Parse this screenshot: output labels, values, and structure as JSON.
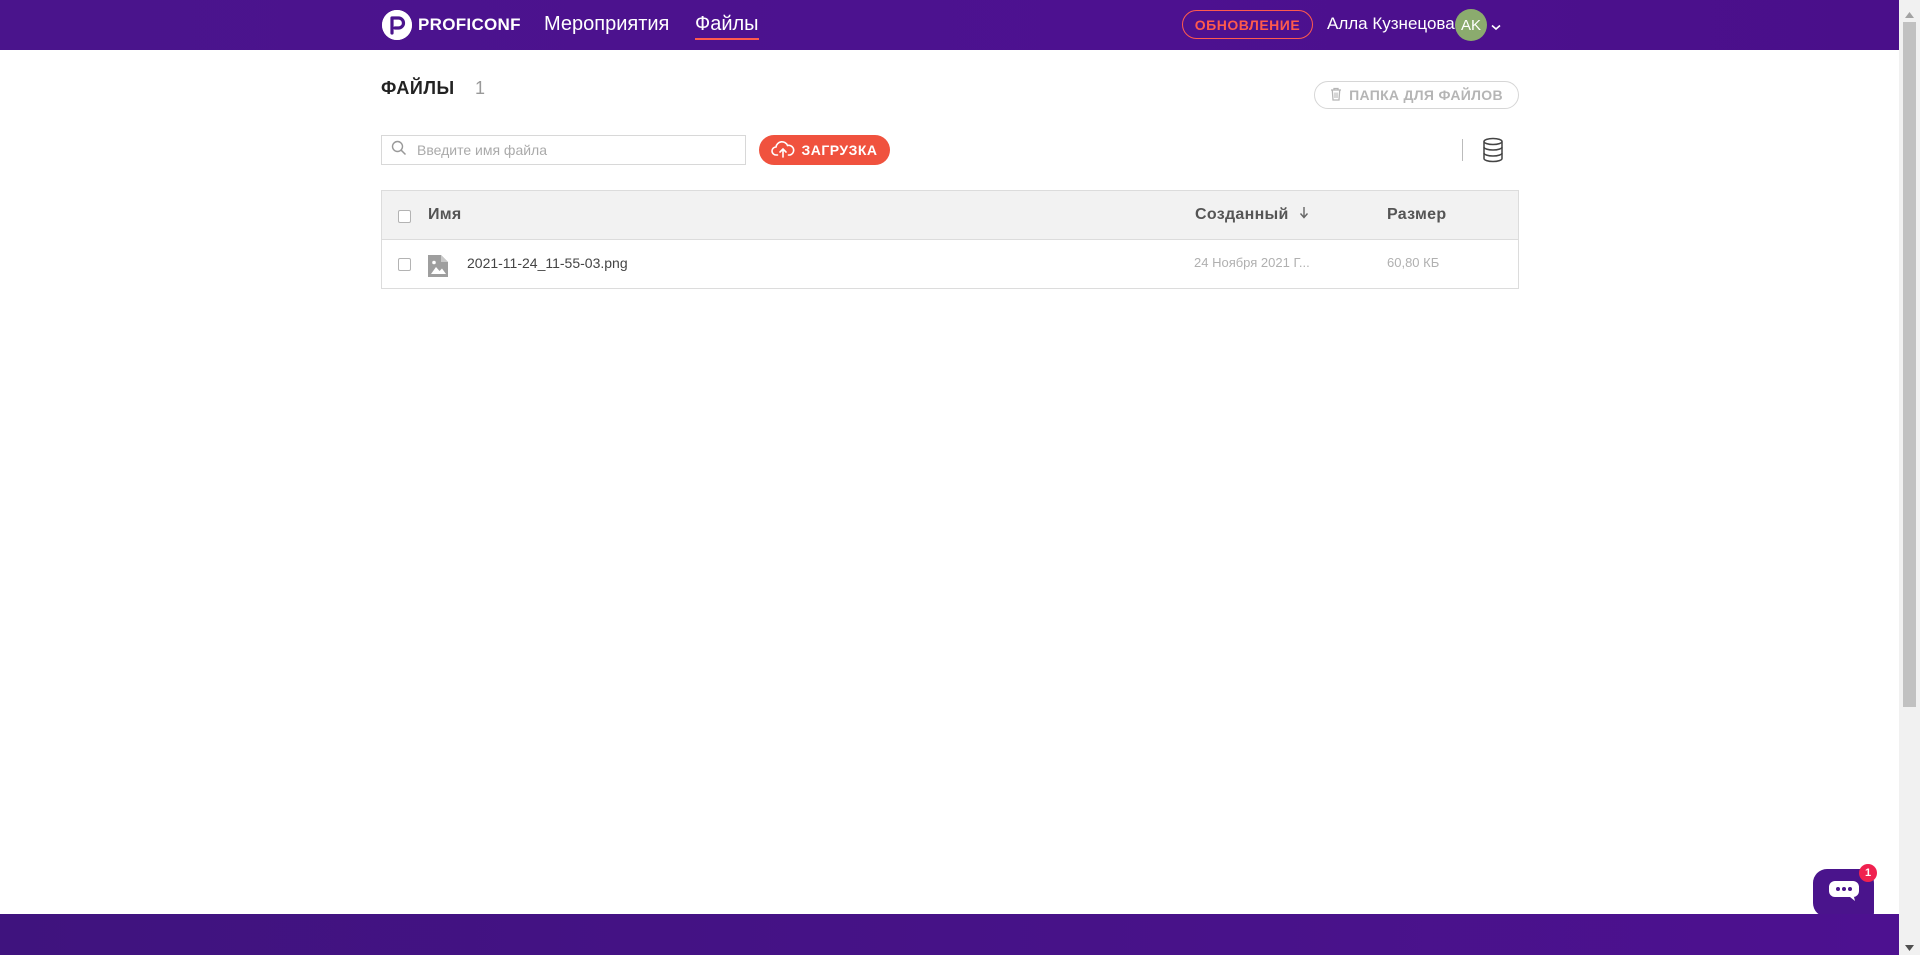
{
  "header": {
    "logo_text": "PROFICONF",
    "nav": {
      "events_label": "Мероприятия",
      "files_label": "Файлы"
    },
    "update_button_label": "ОБНОВЛЕНИЕ",
    "user": {
      "name": "Алла Кузнецова",
      "initials": "AK",
      "avatar_color": "#8bab6e"
    }
  },
  "page": {
    "title": "ФАЙЛЫ",
    "count": "1",
    "folder_button_label": "ПАПКА ДЛЯ ФАЙЛОВ"
  },
  "toolbar": {
    "search_placeholder": "Введите имя файла",
    "search_value": "",
    "upload_label": "ЗАГРУЗКА"
  },
  "table": {
    "columns": {
      "name": "Имя",
      "created": "Созданный",
      "size": "Размер"
    },
    "sort": {
      "column": "created",
      "direction": "desc"
    },
    "rows": [
      {
        "name": "2021-11-24_11-55-03.png",
        "created": "24 Ноября 2021 Г...",
        "size": "60,80 КБ",
        "icon": "image-file-icon"
      }
    ]
  },
  "chat": {
    "badge_count": "1"
  },
  "colors": {
    "brand_purple": "#4a148c",
    "accent_red": "#f0523e",
    "update_red": "#ff5a4d",
    "badge_pink": "#f0214f"
  }
}
